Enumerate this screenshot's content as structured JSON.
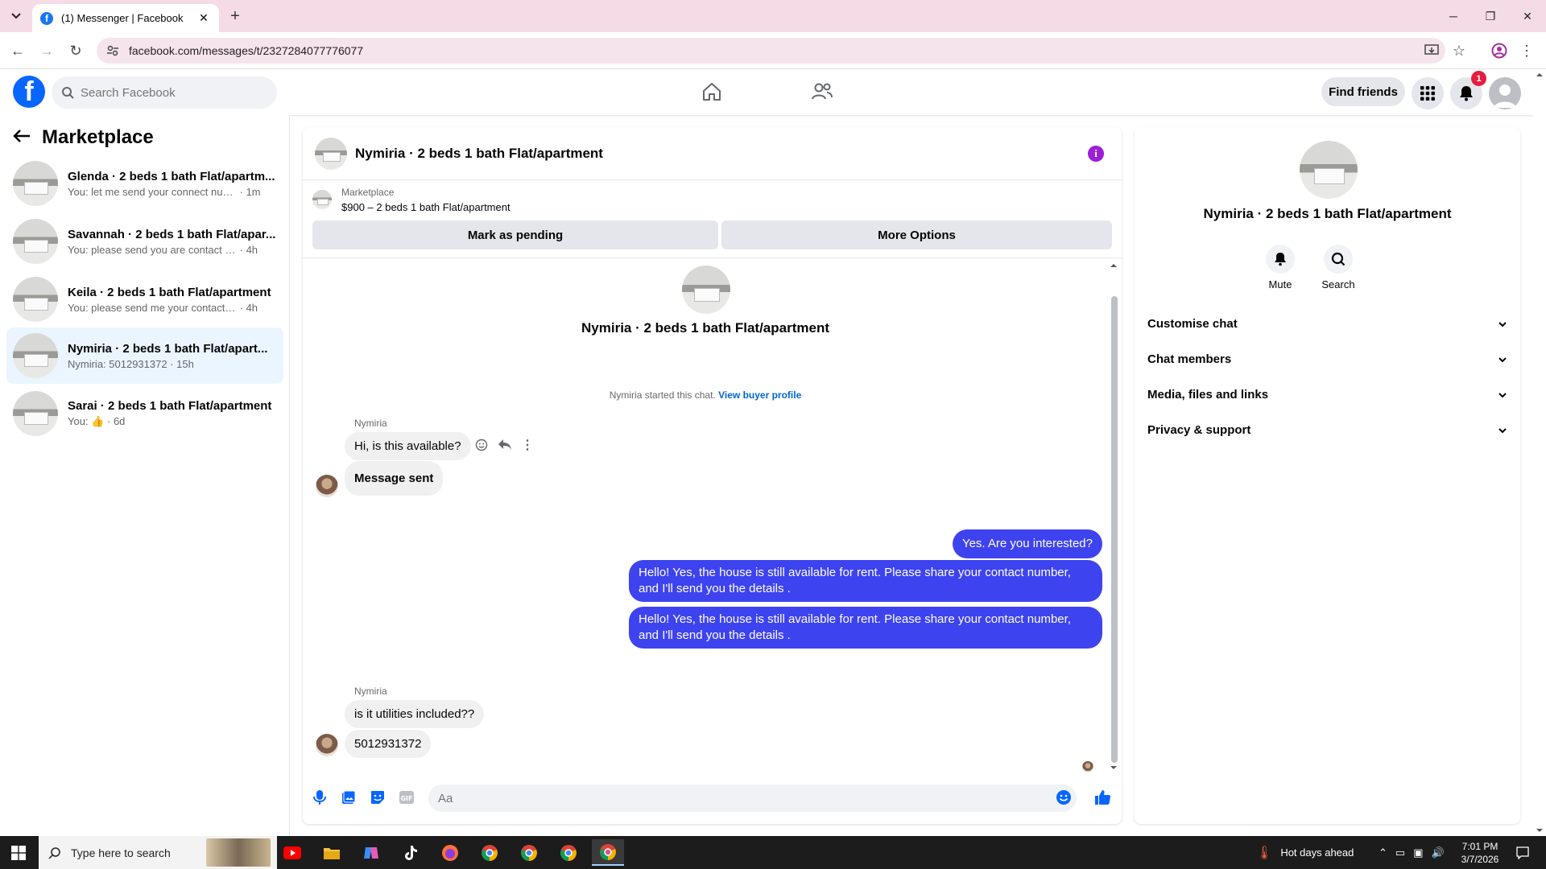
{
  "browser": {
    "tab_title": "(1) Messenger | Facebook",
    "url": "facebook.com/messages/t/2327284077776077"
  },
  "header": {
    "search_placeholder": "Search Facebook",
    "find_friends": "Find friends",
    "notification_count": "1",
    "brand_color": "#0866ff"
  },
  "sidebar": {
    "title": "Marketplace",
    "conversations": [
      {
        "name": "Glenda · 2 beds 1 bath Flat/apartm...",
        "preview": "You: let me send your connect numb...",
        "time": "· 1m"
      },
      {
        "name": "Savannah · 2 beds 1 bath Flat/apar...",
        "preview": "You: please send you are contact num...",
        "time": "· 4h"
      },
      {
        "name": "Keila · 2 beds 1 bath Flat/apartment",
        "preview": "You: please send me your contact nu...",
        "time": "· 4h"
      },
      {
        "name": "Nymiria · 2 beds 1 bath Flat/apart...",
        "preview": "Nymiria: 5012931372",
        "time": "· 15h"
      },
      {
        "name": "Sarai · 2 beds 1 bath Flat/apartment",
        "preview": "You:",
        "time": "· 6d"
      }
    ]
  },
  "chat": {
    "title": "Nymiria · 2 beds 1 bath Flat/apartment",
    "marketplace_label": "Marketplace",
    "listing": "$900 – 2 beds 1 bath Flat/apartment",
    "mark_pending": "Mark as pending",
    "more_options": "More Options",
    "center_name": "Nymiria · 2 beds 1 bath Flat/apartment",
    "started_text": "Nymiria started this chat.",
    "view_buyer_profile": "View buyer profile",
    "sender_name": "Nymiria",
    "messages_in_1": [
      "Hi, is this available?",
      "Message sent"
    ],
    "messages_out": [
      "Yes. Are you interested?",
      "Hello! Yes, the house is still available for rent. Please share your contact number, and I'll send you the details .",
      "Hello! Yes, the house is still available for rent. Please share your contact number, and I'll send you the details ."
    ],
    "messages_in_2": [
      "is it utilities included??",
      "5012931372"
    ],
    "composer_placeholder": "Aa",
    "outgoing_color": "#3e43f0"
  },
  "details": {
    "name": "Nymiria · 2 beds 1 bath Flat/apartment",
    "mute": "Mute",
    "search": "Search",
    "sections": [
      "Customise chat",
      "Chat members",
      "Media, files and links",
      "Privacy & support"
    ]
  },
  "taskbar": {
    "search_placeholder": "Type here to search",
    "weather": "Hot days ahead",
    "time": "7:01 PM",
    "date": "3/7/2026"
  }
}
